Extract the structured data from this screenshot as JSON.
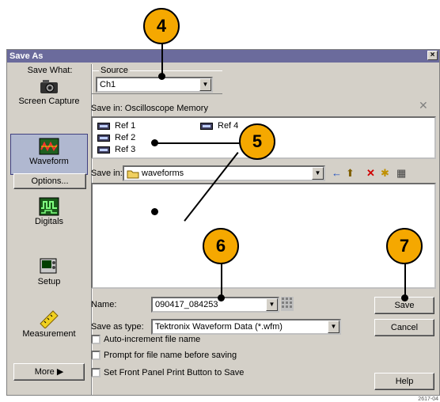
{
  "window": {
    "title": "Save As",
    "close_glyph": "×"
  },
  "left": {
    "heading": "Save What:",
    "items": [
      {
        "label": "Screen Capture",
        "icon": "camera-icon"
      },
      {
        "label": "Waveform",
        "icon": "waveform-icon"
      },
      {
        "label": "Digitals",
        "icon": "digitals-icon"
      },
      {
        "label": "Setup",
        "icon": "setup-icon"
      },
      {
        "label": "Measurement",
        "icon": "ruler-icon"
      }
    ],
    "options_button": "Options...",
    "more_button": "More ▶"
  },
  "source": {
    "label": "Source",
    "value": "Ch1"
  },
  "memory": {
    "label": "Save in: Oscilloscope Memory",
    "refs": [
      "Ref 1",
      "Ref 2",
      "Ref 3",
      "Ref 4"
    ]
  },
  "folder": {
    "label": "Save in:",
    "value": "waveforms",
    "toolbar": [
      "←",
      "⬆",
      "✕",
      "✱",
      "▦"
    ]
  },
  "form": {
    "name_label": "Name:",
    "name_value": "090417_084253",
    "type_label": "Save as type:",
    "type_value": "Tektronix Waveform Data (*.wfm)",
    "checks": [
      "Auto-increment file name",
      "Prompt for file name before saving",
      "Set Front Panel Print Button to Save"
    ]
  },
  "buttons": {
    "save": "Save",
    "cancel": "Cancel",
    "help": "Help"
  },
  "callouts": [
    "4",
    "5",
    "6",
    "7"
  ],
  "figure_code": "2617-04"
}
